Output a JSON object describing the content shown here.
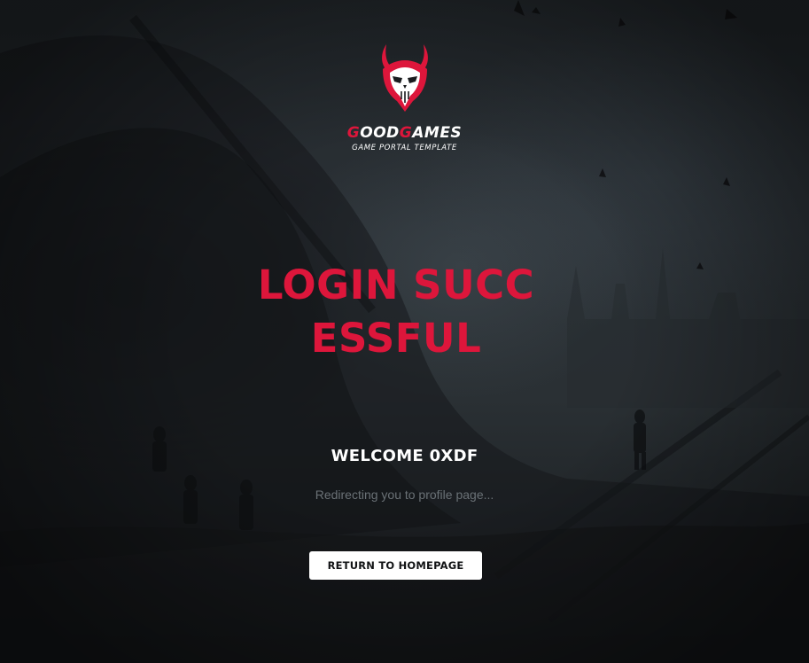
{
  "brand": {
    "name_first_letter": "G",
    "name_part1": "OOD",
    "name_second_letter": "G",
    "name_part2": "AMES",
    "tagline": "GAME PORTAL TEMPLATE",
    "logo_icon": "demon-skull-icon"
  },
  "main": {
    "title": "LOGIN SUCCESSFUL",
    "welcome": "WELCOME 0XDF",
    "redirect_text": "Redirecting you to profile page...",
    "return_button_label": "RETURN TO HOMEPAGE"
  },
  "colors": {
    "accent": "#dd163b",
    "text_light": "#ffffff",
    "muted": "#6a7176",
    "background": "#22272b"
  }
}
